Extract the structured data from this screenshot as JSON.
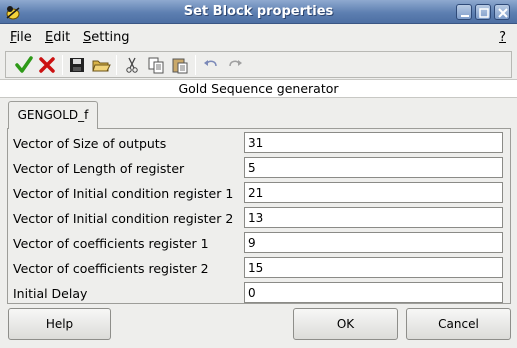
{
  "window": {
    "title": "Set Block properties"
  },
  "menu": {
    "file": {
      "mnemonic": "F",
      "rest": "ile"
    },
    "edit": {
      "mnemonic": "E",
      "rest": "dit"
    },
    "setting": {
      "mnemonic": "S",
      "rest": "etting"
    },
    "help": "?"
  },
  "toolbar": {
    "icons": [
      "ok-check-icon",
      "cancel-x-icon",
      "save-icon",
      "open-folder-icon",
      "cut-icon",
      "copy-icon",
      "paste-icon",
      "undo-icon",
      "redo-icon"
    ],
    "colors": {
      "check": "#2e9a18",
      "cross": "#cc1111"
    }
  },
  "block": {
    "description": "Gold Sequence generator",
    "tab_label": "GENGOLD_f"
  },
  "params": [
    {
      "label": "Vector of Size of outputs",
      "value": "31"
    },
    {
      "label": "Vector of Length of register",
      "value": "5"
    },
    {
      "label": "Vector of Initial condition register 1",
      "value": "21"
    },
    {
      "label": "Vector of Initial condition register 2",
      "value": "13"
    },
    {
      "label": "Vector of coefficients register 1",
      "value": "9"
    },
    {
      "label": "Vector of coefficients register 2",
      "value": "15"
    },
    {
      "label": "Initial Delay",
      "value": "0"
    }
  ],
  "buttons": {
    "help": "Help",
    "ok": "OK",
    "cancel": "Cancel"
  }
}
